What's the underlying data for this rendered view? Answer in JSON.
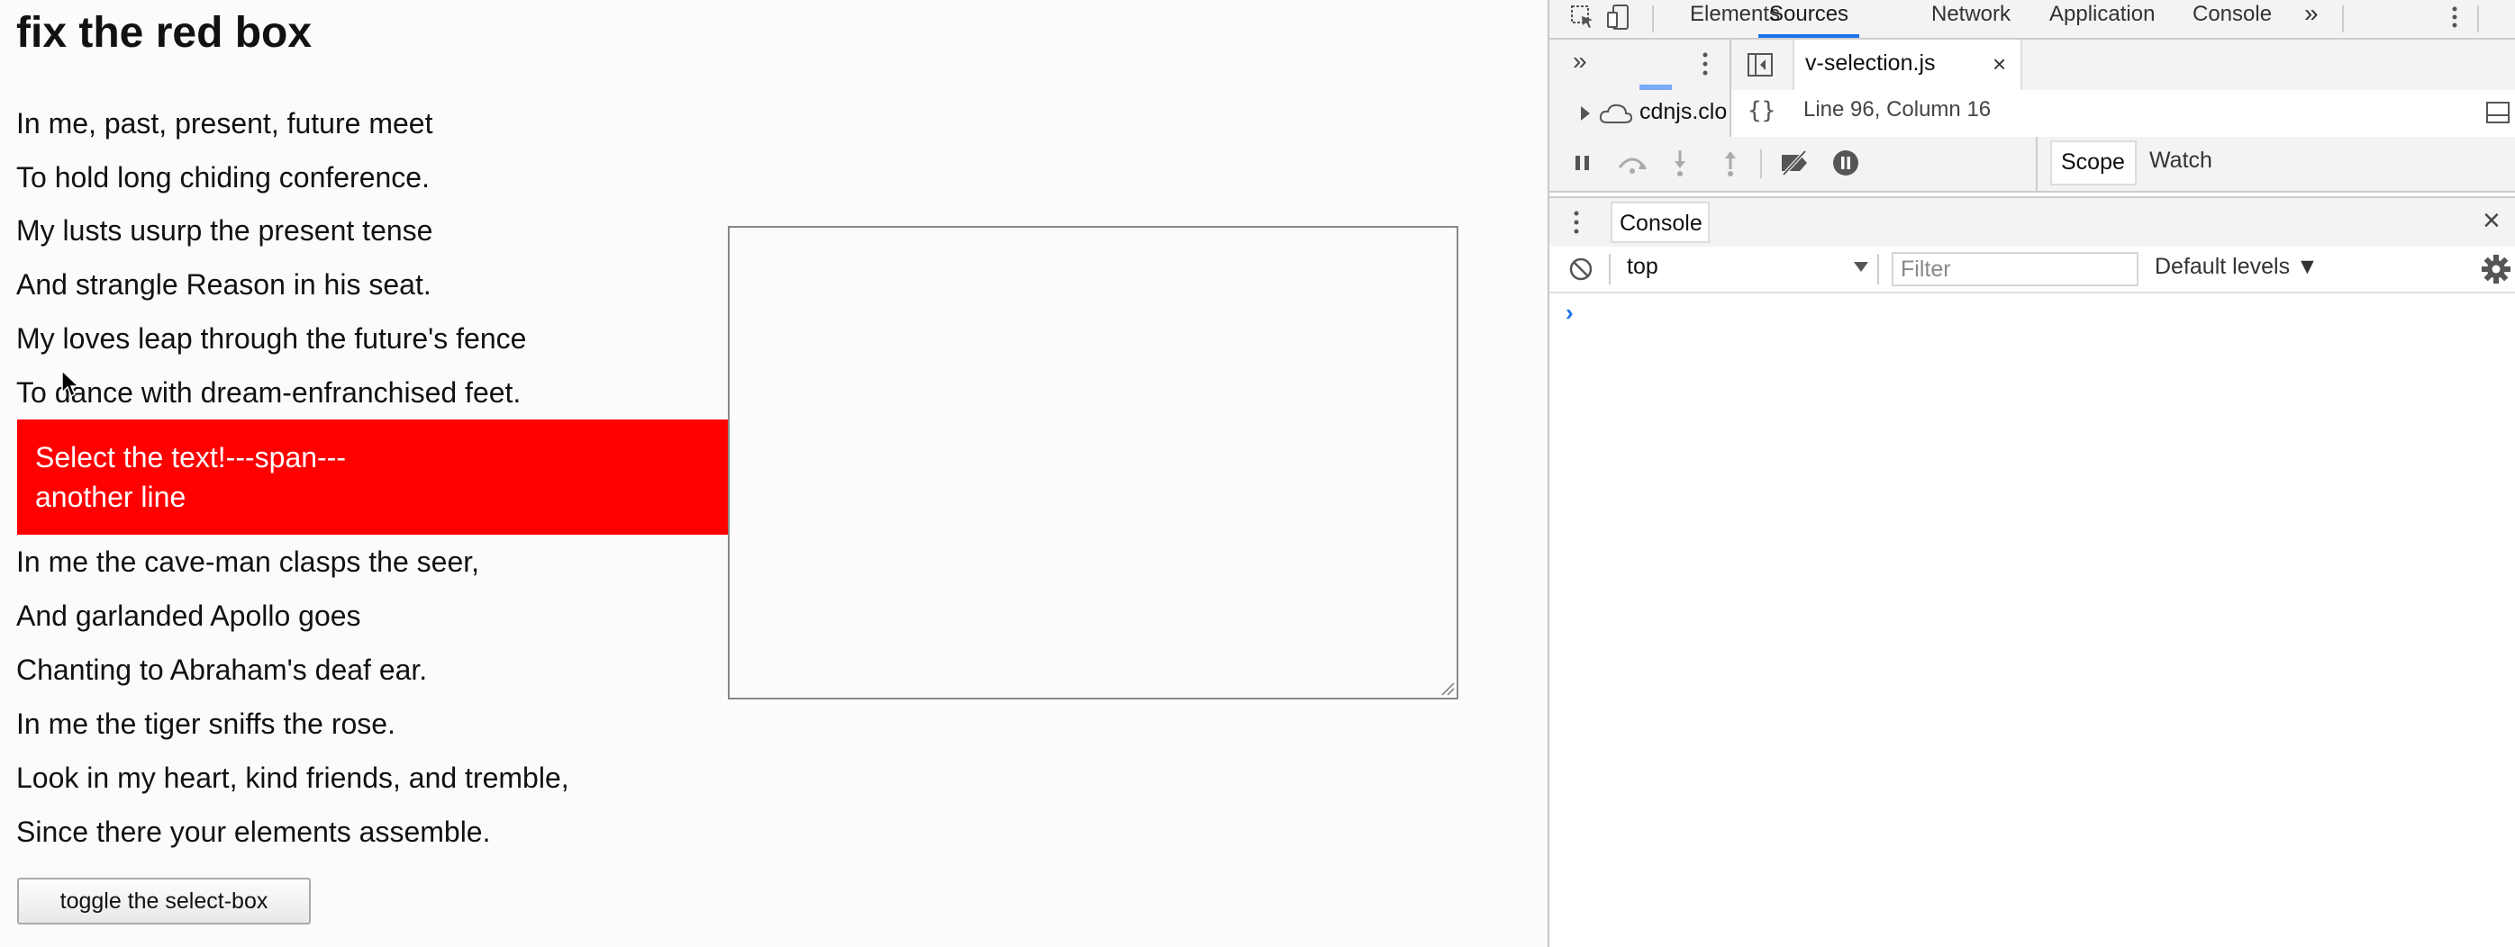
{
  "page": {
    "title": "fix the red box",
    "poem_top": [
      "In me, past, present, future meet",
      "To hold long chiding conference.",
      "My lusts usurp the present tense",
      "And strangle Reason in his seat.",
      "My loves leap through the future's fence",
      "To dance with dream-enfranchised feet."
    ],
    "red_box": {
      "line1": "Select the text!---span---",
      "line2": "another line",
      "color": "#ff0000"
    },
    "poem_bottom": [
      "In me the cave-man clasps the seer,",
      "And garlanded Apollo goes",
      "Chanting to Abraham's deaf ear.",
      "In me the tiger sniffs the rose.",
      "Look in my heart, kind friends, and tremble,",
      "Since there your elements assemble."
    ],
    "toggle_button": "toggle the select-box"
  },
  "devtools": {
    "tabs": [
      "Elements",
      "Sources",
      "Network",
      "Application",
      "Console"
    ],
    "active_tab": "Sources",
    "more_tabs": "»",
    "sources": {
      "more": "»",
      "file_tab": "v-selection.js",
      "close": "×",
      "tree_item": "cdnjs.clou",
      "format_icon": "{}",
      "status": "Line 96, Column 16"
    },
    "debugger": {
      "scope": "Scope",
      "watch": "Watch"
    },
    "drawer": {
      "tab": "Console",
      "close": "×"
    },
    "console": {
      "context": "top",
      "filter_placeholder": "Filter",
      "levels": "Default levels ▼",
      "prompt": "›"
    },
    "accent": "#1a73e8"
  }
}
